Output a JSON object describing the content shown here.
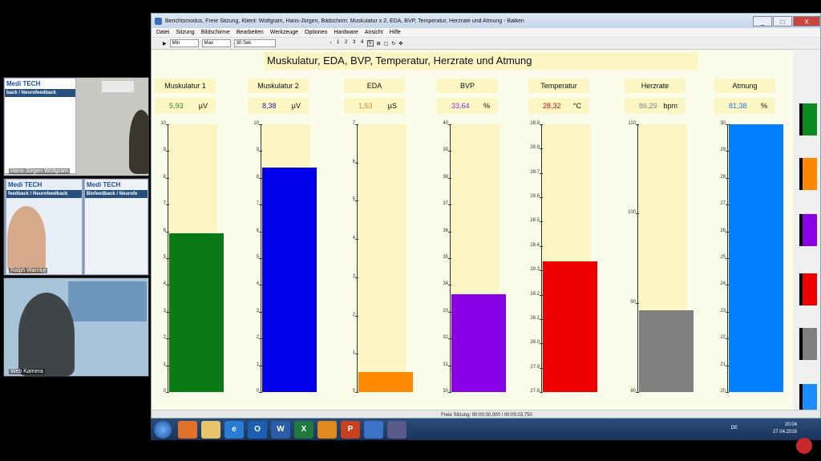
{
  "feeds": [
    {
      "label": "Hans-Jürgen Wolfgram",
      "poster_brand": "Medi TECH",
      "poster_band": "back / Neurofeedback"
    },
    {
      "label": "Ralph Warnke",
      "poster_brand": "Medi TECH",
      "poster_band": "feedback / Neurofeedback",
      "poster2_band": "Biofeedback / Neurofe"
    },
    {
      "label": "Web Kamera"
    }
  ],
  "window": {
    "title": "Berichtsmodus, Freie Sitzung, Klient: Wolfgram, Hans-Jürgen, Bildschirm: Muskulatur x 2, EDA, BVP, Temperatur, Herzrate und Atmung - Balken",
    "btn_min": "_",
    "btn_max": "□",
    "btn_close": "X"
  },
  "menu": [
    "Datei",
    "Sitzung",
    "Bildschirme",
    "Bearbeiten",
    "Werkzeuge",
    "Optionen",
    "Hardware",
    "Ansicht",
    "Hilfe"
  ],
  "toolbar": {
    "min_label": "Min",
    "max_label": "Max",
    "interval": "30 Sek",
    "pages": [
      "1",
      "2",
      "3",
      "4",
      "5"
    ],
    "active_page": "5"
  },
  "screen_title": "Muskulatur, EDA, BVP, Temperatur, Herzrate und Atmung",
  "channels": [
    {
      "name": "Muskulatur 1",
      "value": "5,93",
      "unit": "µV",
      "color": "#0a7a17",
      "value_color": "#2e8b2e",
      "min": 0,
      "max": 10,
      "level": 5.93,
      "ticks": [
        "10",
        "9",
        "8",
        "7",
        "6",
        "5",
        "4",
        "3",
        "2",
        "1",
        "0"
      ]
    },
    {
      "name": "Muskulatur 2",
      "value": "8,38",
      "unit": "µV",
      "color": "#0000ee",
      "value_color": "#1a1ab0",
      "min": 0,
      "max": 10,
      "level": 8.38,
      "ticks": [
        "10",
        "9",
        "8",
        "7",
        "6",
        "5",
        "4",
        "3",
        "2",
        "1",
        "0"
      ]
    },
    {
      "name": "EDA",
      "value": "1,53",
      "unit": "µS",
      "color": "#ff8800",
      "value_color": "#f08a20",
      "min": 0,
      "max": 7,
      "level": 0.53,
      "ticks": [
        "7",
        "6",
        "5",
        "4",
        "3",
        "2",
        "1",
        "0"
      ]
    },
    {
      "name": "BVP",
      "value": "33,64",
      "unit": "%",
      "color": "#8a00e6",
      "value_color": "#8a2be2",
      "min": 30,
      "max": 40,
      "level": 33.64,
      "ticks": [
        "40",
        "39",
        "38",
        "37",
        "36",
        "35",
        "34",
        "33",
        "32",
        "31",
        "30"
      ]
    },
    {
      "name": "Temperatur",
      "value": "28,32",
      "unit": "°C",
      "color": "#ee0000",
      "value_color": "#d01010",
      "min": 27.75,
      "max": 28.92,
      "level": 28.32,
      "ticks": [
        "28.9",
        "28.8",
        "28.7",
        "28.6",
        "28.5",
        "28.4",
        "28.3",
        "28.2",
        "28.1",
        "28.0",
        "27.9",
        "27.8"
      ]
    },
    {
      "name": "Herzrate",
      "value": "86,29",
      "unit": "bpm",
      "color": "#7f7f7f",
      "value_color": "#888888",
      "min": 75,
      "max": 112,
      "level": 86.29,
      "ticks": [
        "110",
        "100",
        "90",
        "80"
      ]
    },
    {
      "name": "Atmung",
      "value": "81,38",
      "unit": "%",
      "color": "#0080ff",
      "value_color": "#1a7ad9",
      "min": 20,
      "max": 30,
      "level": 30,
      "ticks": [
        "30",
        "29",
        "28",
        "27",
        "26",
        "25",
        "24",
        "23",
        "22",
        "21",
        "20"
      ]
    }
  ],
  "right_swatches": [
    "#0a8a1f",
    "#ff8800",
    "#8a00e6",
    "#ee0000",
    "#7f7f7f",
    "#1a8cff"
  ],
  "status": "Freie Sitzung: 00:00:30,000 / 00:05:03,750",
  "taskbar": {
    "apps": [
      "",
      "",
      "",
      "e",
      "O",
      "W",
      "X",
      "",
      "P",
      "",
      ""
    ],
    "lang": "DE",
    "time": "20:04",
    "date": "27.04.2018"
  }
}
